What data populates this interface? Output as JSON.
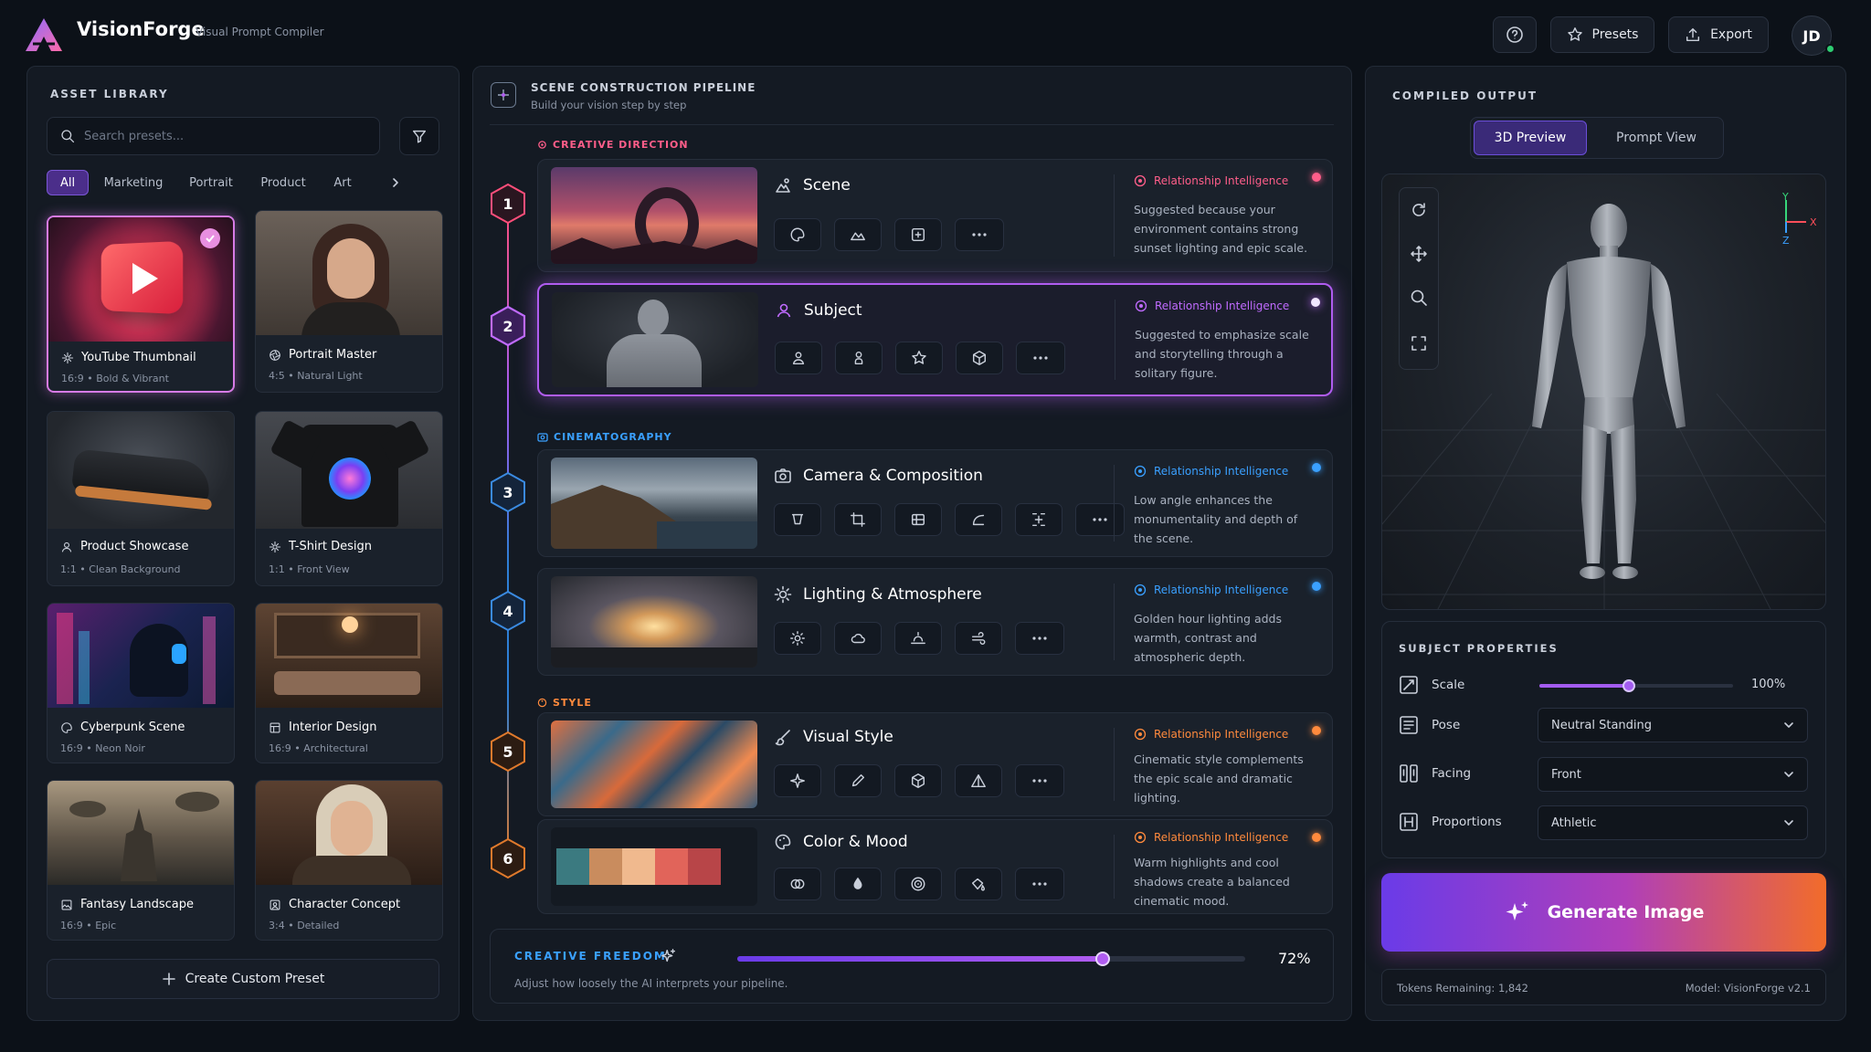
{
  "app": {
    "title": "VisionForge",
    "subtitle": "Visual Prompt Compiler"
  },
  "topbar": {
    "presets_label": "Presets",
    "export_label": "Export",
    "avatar_initials": "JD"
  },
  "library": {
    "title": "ASSET LIBRARY",
    "search_placeholder": "Search presets...",
    "filters": [
      "All",
      "Marketing",
      "Portrait",
      "Product",
      "Art"
    ],
    "cards": [
      {
        "title": "YouTube Thumbnail",
        "ratio": "16:9",
        "desc": "Bold & Vibrant",
        "icon": "sparkle-icon",
        "selected": true
      },
      {
        "title": "Portrait Master",
        "ratio": "4:5",
        "desc": "Natural Light",
        "icon": "aperture-icon"
      },
      {
        "title": "Product Showcase",
        "ratio": "1:1",
        "desc": "Clean Background",
        "icon": "user-icon"
      },
      {
        "title": "T-Shirt Design",
        "ratio": "1:1",
        "desc": "Front View",
        "icon": "sparkle-icon"
      },
      {
        "title": "Cyberpunk Scene",
        "ratio": "16:9",
        "desc": "Neon Noir",
        "icon": "palette-icon"
      },
      {
        "title": "Interior Design",
        "ratio": "16:9",
        "desc": "Architectural",
        "icon": "layout-icon"
      },
      {
        "title": "Fantasy Landscape",
        "ratio": "16:9",
        "desc": "Epic",
        "icon": "image-icon"
      },
      {
        "title": "Character Concept",
        "ratio": "3:4",
        "desc": "Detailed",
        "icon": "frame-icon"
      }
    ],
    "create_label": "Create Custom Preset"
  },
  "pipeline": {
    "title": "SCENE CONSTRUCTION PIPELINE",
    "subtitle": "Build your vision step by step",
    "sections": {
      "creative": "CREATIVE DIRECTION",
      "cinema": "CINEMATOGRAPHY",
      "style": "STYLE"
    },
    "ri_label": "Relationship Intelligence",
    "stages": [
      {
        "num": "1",
        "title": "Scene",
        "text": "Suggested because your environment contains strong sunset lighting and epic scale."
      },
      {
        "num": "2",
        "title": "Subject",
        "text": "Suggested to emphasize scale and storytelling through a solitary figure."
      },
      {
        "num": "3",
        "title": "Camera & Composition",
        "text": "Low angle enhances the monumentality and depth of the scene."
      },
      {
        "num": "4",
        "title": "Lighting & Atmosphere",
        "text": "Golden hour lighting adds warmth, contrast and atmospheric depth."
      },
      {
        "num": "5",
        "title": "Visual Style",
        "text": "Cinematic style complements the epic scale and dramatic lighting."
      },
      {
        "num": "6",
        "title": "Color & Mood",
        "text": "Warm highlights and cool shadows create a balanced cinematic mood."
      }
    ],
    "palette": [
      "#3b7a80",
      "#c98c5e",
      "#f0b98e",
      "#e1645a",
      "#b84548"
    ],
    "freedom": {
      "label": "CREATIVE FREEDOM",
      "value": "72%",
      "fraction": 0.72,
      "desc": "Adjust how loosely the AI interprets your pipeline."
    }
  },
  "output": {
    "title": "COMPILED OUTPUT",
    "tabs": [
      "3D Preview",
      "Prompt View"
    ],
    "axes": {
      "y": "Y",
      "x": "X",
      "z": "Z"
    },
    "properties": {
      "title": "SUBJECT PROPERTIES",
      "scale_label": "Scale",
      "scale_value": "100%",
      "scale_fraction": 0.46,
      "pose_label": "Pose",
      "pose_value": "Neutral Standing",
      "facing_label": "Facing",
      "facing_value": "Front",
      "proportions_label": "Proportions",
      "proportions_value": "Athletic"
    },
    "generate_label": "Generate Image",
    "tokens": "Tokens Remaining: 1,842",
    "model": "Model: VisionForge v2.1"
  },
  "colors": {
    "accent": "#a35cf0",
    "pink": "#ff5e8a",
    "blue": "#3aa0ff",
    "orange": "#ff8a3d"
  }
}
